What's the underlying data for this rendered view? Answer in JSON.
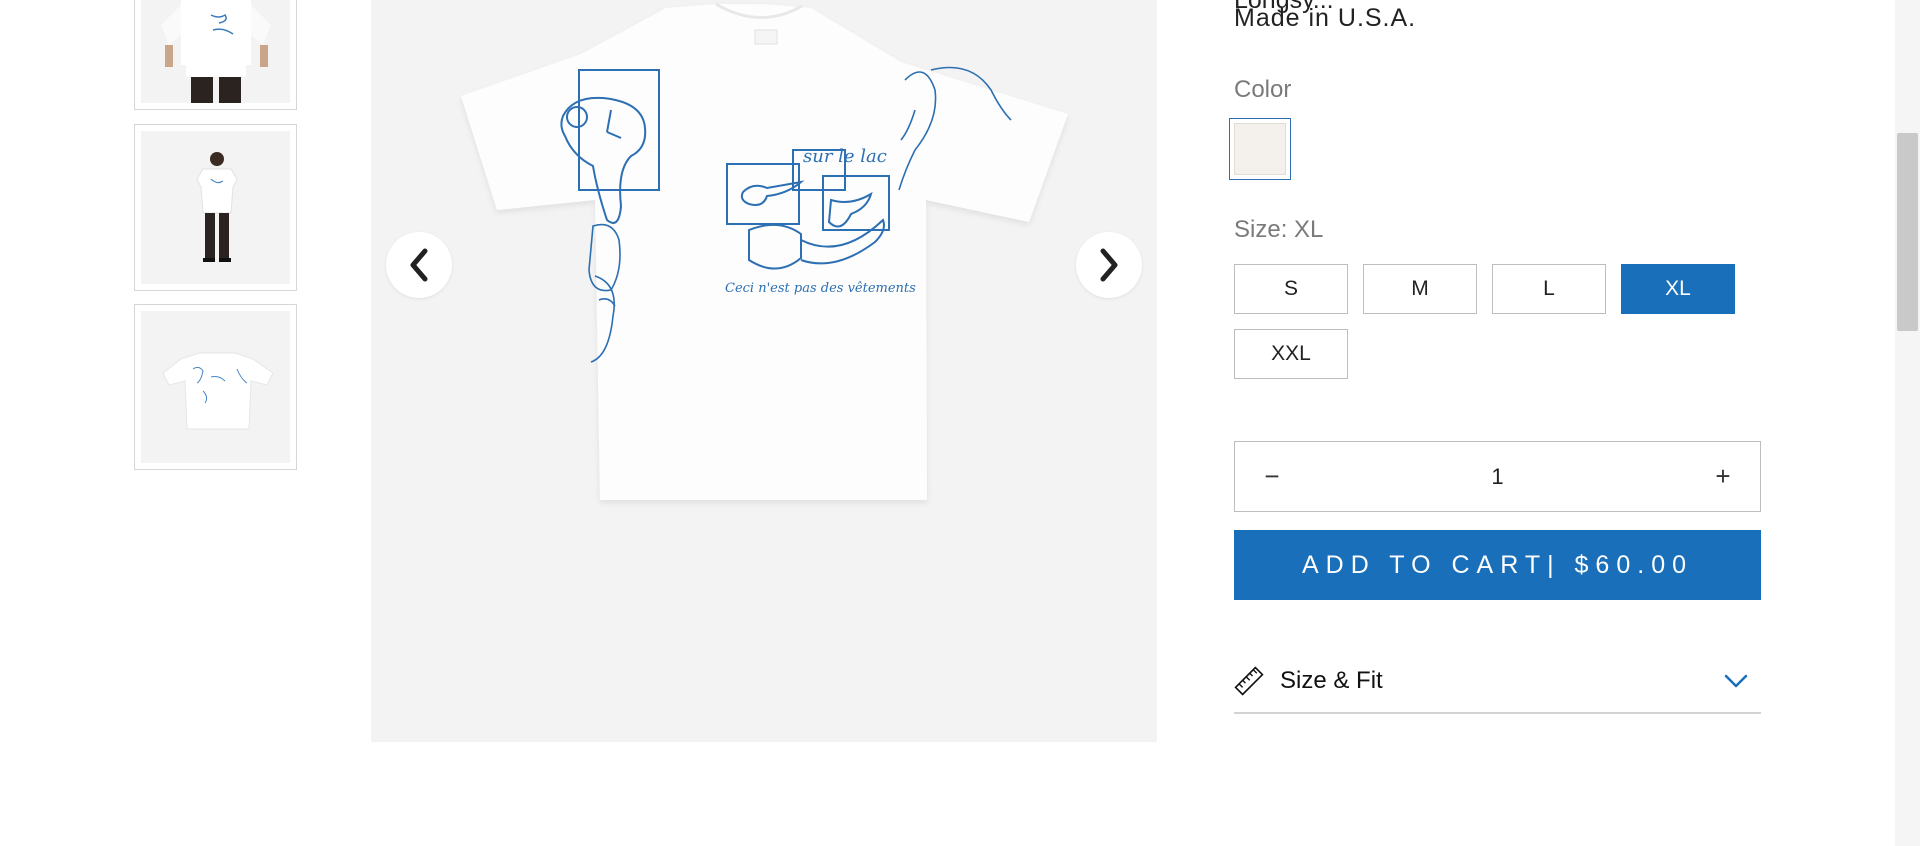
{
  "product": {
    "truncated_line": "Longsy...",
    "made_in": "Made in U.S.A.",
    "color_label": "Color",
    "color_swatch": {
      "name": "Off White",
      "hex": "#f4f1ec"
    },
    "size_label": "Size: XL",
    "sizes": [
      "S",
      "M",
      "L",
      "XL",
      "XXL"
    ],
    "selected_size": "XL",
    "quantity": "1",
    "minus_symbol": "−",
    "plus_symbol": "+",
    "add_to_cart": "ADD TO CART| $60.00",
    "size_fit_label": "Size & Fit"
  },
  "gallery": {
    "shirt_caption": "Ceci n'est pas des vêtements",
    "shirt_brand": "sur le lac"
  },
  "colors": {
    "accent": "#1a6fba",
    "image_bg": "#f3f3f3",
    "border": "#bdbdbd"
  }
}
